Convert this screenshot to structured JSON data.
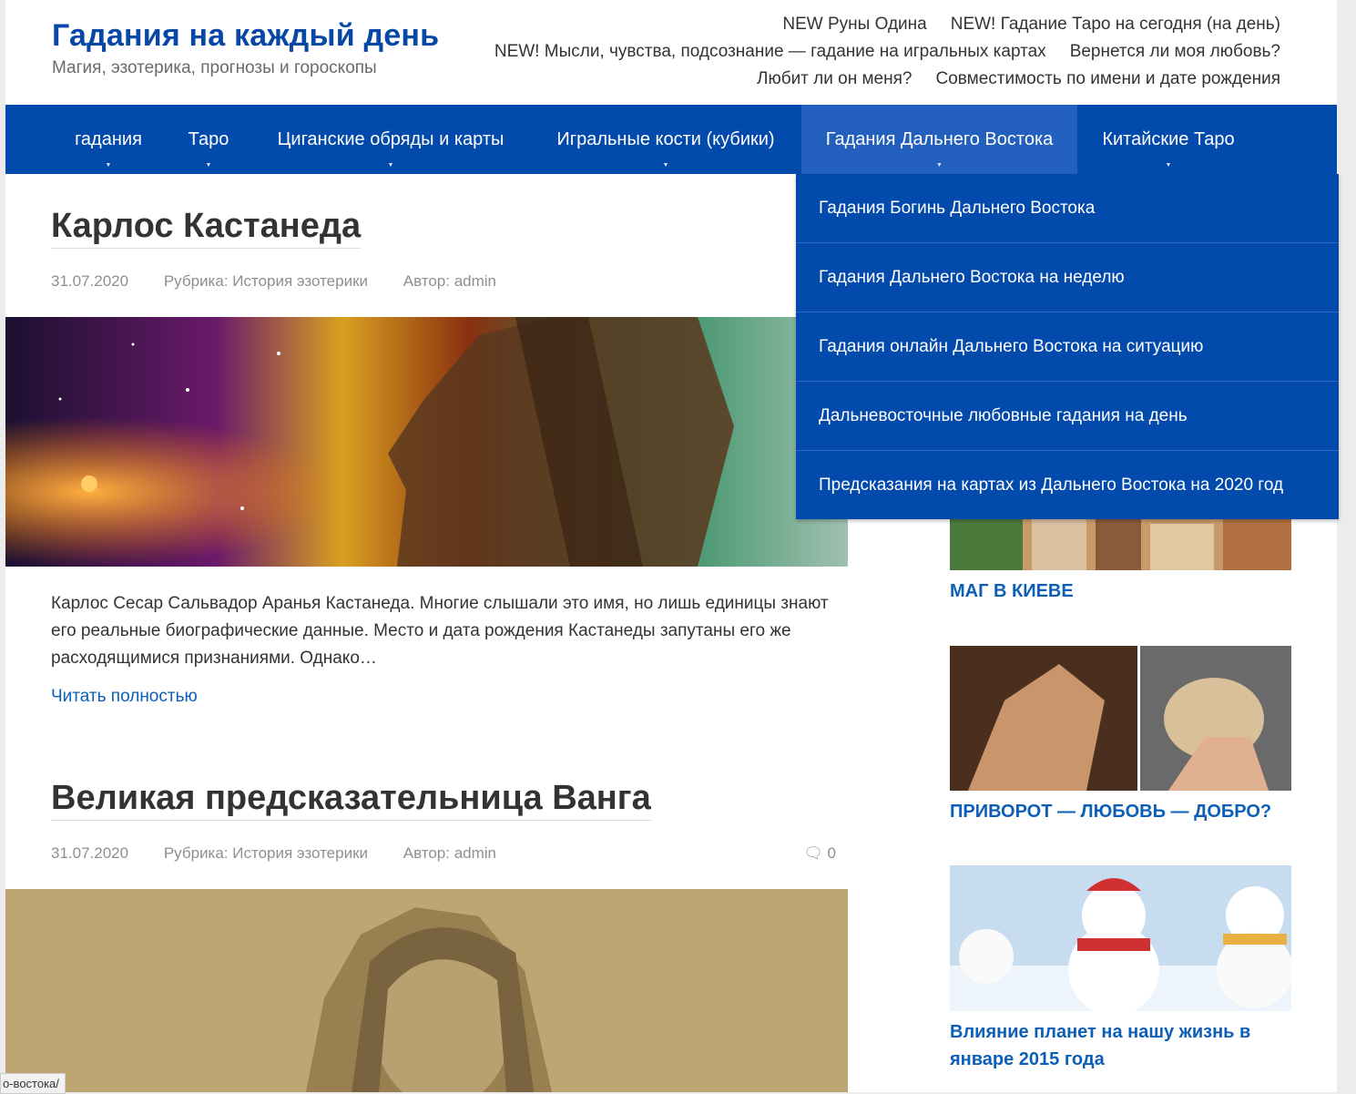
{
  "site": {
    "title": "Гадания на каждый день",
    "description": "Магия, эзотерика, прогнозы и гороскопы"
  },
  "top_links": [
    "NEW Руны Одина",
    "NEW! Гадание Таро на сегодня (на день)",
    "NEW! Мысли, чувства, подсознание — гадание на игральных картах",
    "Вернется ли моя любовь?",
    "Любит ли он меня?",
    "Совместимость по имени и дате рождения"
  ],
  "nav": [
    {
      "label": "гадания"
    },
    {
      "label": "Таро"
    },
    {
      "label": "Циганские обряды и карты"
    },
    {
      "label": "Игральные кости (кубики)"
    },
    {
      "label": "Гадания Дальнего Востока"
    },
    {
      "label": "Китайские Таро"
    }
  ],
  "dropdown": [
    "Гадания Богинь Дальнего Востока",
    "Гадания Дальнего Востока на неделю",
    "Гадания онлайн Дальнего Востока на ситуацию",
    "Дальневосточные любовные гадания на день",
    "Предсказания на картах из Дальнего Востока на 2020 год"
  ],
  "posts": [
    {
      "title": "Карлос Кастанеда",
      "date": "31.07.2020",
      "category": "Рубрика: История эзотерики",
      "author": "Автор: admin",
      "excerpt": "Карлос Сесар Сальвадор Аранья Кастанеда. Многие слышали это имя, но лишь единицы знают его реальные биографические данные. Место и дата рождения Кастанеды запутаны его же расходящимися признаниями. Однако…",
      "read_more": "Читать полностью"
    },
    {
      "title": "Великая предсказательница Ванга",
      "date": "31.07.2020",
      "category": "Рубрика: История эзотерики",
      "author": "Автор: admin",
      "comments": "0"
    }
  ],
  "sidebar": [
    {
      "title": "МАГ В КИЕВЕ"
    },
    {
      "title": "ПРИВОРОТ — ЛЮБОВЬ — ДОБРО?"
    },
    {
      "title": "Влияние планет на нашу жизнь в январе 2015 года"
    }
  ],
  "status_url": "о-востока/",
  "colors": {
    "brand": "#0747a6",
    "nav_bg": "#034aad",
    "link": "#0c5fb8"
  }
}
